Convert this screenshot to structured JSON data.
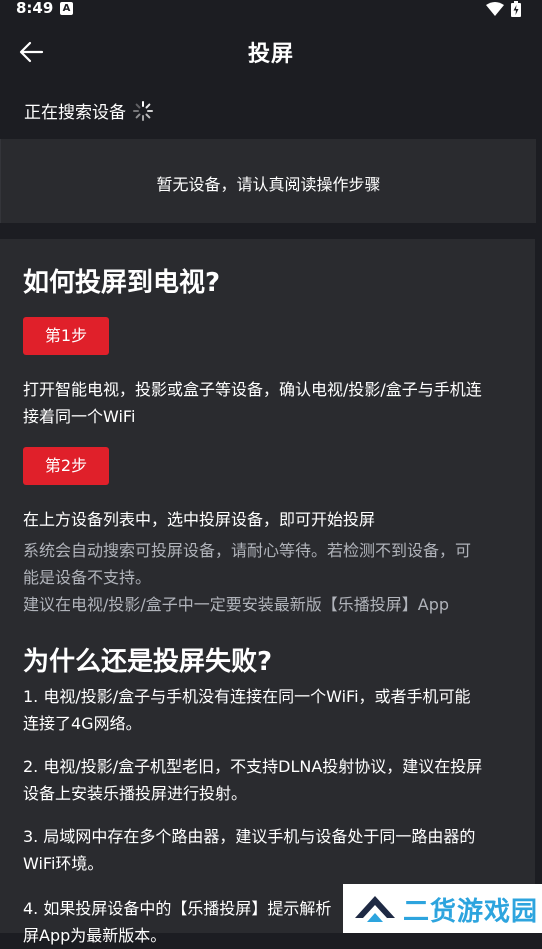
{
  "status_bar": {
    "time": "8:49",
    "notification_letter": "A"
  },
  "app_bar": {
    "title": "投屏"
  },
  "search": {
    "label": "正在搜索设备"
  },
  "device_list": {
    "empty_text": "暂无设备，请认真阅读操作步骤"
  },
  "guide": {
    "how_title": "如何投屏到电视?",
    "step1_label": "第1步",
    "step1_text_1": "打开智能电视，投影或盒子等设备，确认电视/投影/盒子与手机连",
    "step1_text_2": "接着同一个WiFi",
    "step2_label": "第2步",
    "step2_text": "在上方设备列表中，选中投屏设备，即可开始投屏",
    "step2_note_1": "系统会自动搜索可投屏设备，请耐心等待。若检测不到设备，可",
    "step2_note_2": "能是设备不支持。",
    "step2_note_3": "建议在电视/投影/盒子中一定要安装最新版【乐播投屏】App",
    "why_title": "为什么还是投屏失败?",
    "reason1_1": "1. 电视/投影/盒子与手机没有连接在同一个WiFi，或者手机可能",
    "reason1_2": "连接了4G网络。",
    "reason2_1": " 2. 电视/投影/盒子机型老旧，不支持DLNA投射协议，建议在投屏",
    "reason2_2": "设备上安装乐播投屏进行投射。",
    "reason3_1": " 3. 局域网中存在多个路由器，建议手机与设备处于同一路由器的",
    "reason3_2": "WiFi环境。",
    "reason4_1": " 4. 如果投屏设备中的【乐播投屏】提示解析",
    "reason4_2": "屏App为最新版本。"
  },
  "watermark": {
    "text": "二货游戏园"
  },
  "colors": {
    "background": "#1c1d22",
    "panel": "#2a2b2f",
    "accent_red": "#e0202a",
    "muted_text": "#b0b3ba",
    "watermark_blue": "#2da4de"
  },
  "icons": [
    "arrow-left-icon",
    "loading-spinner-icon",
    "wifi-icon",
    "battery-icon"
  ]
}
